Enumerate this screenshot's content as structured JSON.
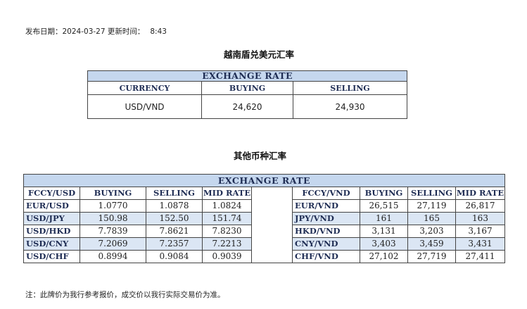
{
  "publish": {
    "label": "发布日期：",
    "date": "2024-03-27",
    "update_label": "更新时间：",
    "time": "8:43"
  },
  "usd_section": {
    "title": "越南盾兑美元汇率",
    "header": "EXCHANGE RATE",
    "columns": [
      "CURRENCY",
      "BUYING",
      "SELLING"
    ],
    "row": {
      "currency": "USD/VND",
      "buying": "24,620",
      "selling": "24,930"
    }
  },
  "other_section": {
    "title": "其他币种汇率",
    "header": "EXCHANGE  RATE",
    "left_columns": [
      "FCCY/USD",
      "BUYING",
      "SELLING",
      "MID RATE"
    ],
    "right_columns": [
      "FCCY/VND",
      "BUYING",
      "SELLING",
      "MID RATE"
    ],
    "left_rows": [
      {
        "pair": "EUR/USD",
        "buying": "1.0770",
        "selling": "1.0878",
        "mid": "1.0824"
      },
      {
        "pair": "USD/JPY",
        "buying": "150.98",
        "selling": "152.50",
        "mid": "151.74"
      },
      {
        "pair": "USD/HKD",
        "buying": "7.7839",
        "selling": "7.8621",
        "mid": "7.8230"
      },
      {
        "pair": "USD/CNY",
        "buying": "7.2069",
        "selling": "7.2357",
        "mid": "7.2213"
      },
      {
        "pair": "USD/CHF",
        "buying": "0.8994",
        "selling": "0.9084",
        "mid": "0.9039"
      }
    ],
    "right_rows": [
      {
        "pair": "EUR/VND",
        "buying": "26,515",
        "selling": "27,119",
        "mid": "26,817"
      },
      {
        "pair": "JPY/VND",
        "buying": "161",
        "selling": "165",
        "mid": "163"
      },
      {
        "pair": "HKD/VND",
        "buying": "3,131",
        "selling": "3,203",
        "mid": "3,167"
      },
      {
        "pair": "CNY/VND",
        "buying": "3,403",
        "selling": "3,459",
        "mid": "3,431"
      },
      {
        "pair": "CHF/VND",
        "buying": "27,102",
        "selling": "27,719",
        "mid": "27,411"
      }
    ]
  },
  "note": "注：此牌价为我行参考报价，成交价以我行实际交易价为准。",
  "colors": {
    "header_bg": "#c5d7ee",
    "alt_row_bg": "#dbe6f4",
    "header_text": "#1f2d54"
  }
}
